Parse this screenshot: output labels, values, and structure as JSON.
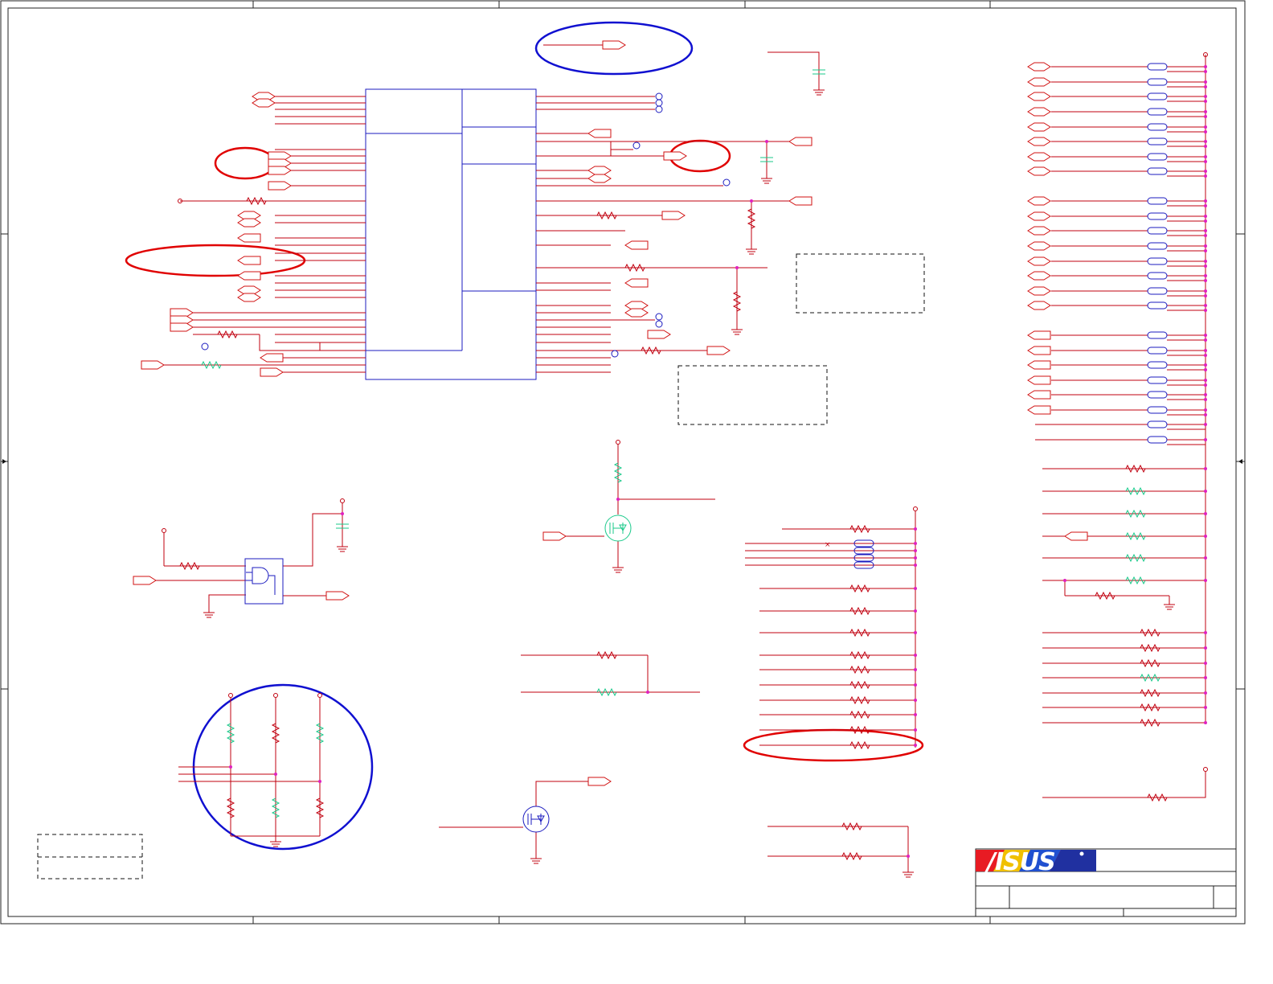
{
  "document": {
    "type": "schematic",
    "brand_logo": "ASUS"
  },
  "colors": {
    "wire": "#c0000f",
    "ic_outline": "#1b1bbf",
    "junction": "#e020c0",
    "component_alt": "#19c98a",
    "highlight_red": "#e00000",
    "highlight_blue": "#1010d0"
  },
  "icons": {
    "resistor": "resistor-icon",
    "ground": "ground-icon",
    "capacitor": "capacitor-icon",
    "mosfet": "mosfet-icon",
    "and_gate": "and-gate-icon",
    "port": "port-arrow-icon",
    "bead": "ferrite-bead-icon",
    "logo": "asus-logo-icon"
  }
}
